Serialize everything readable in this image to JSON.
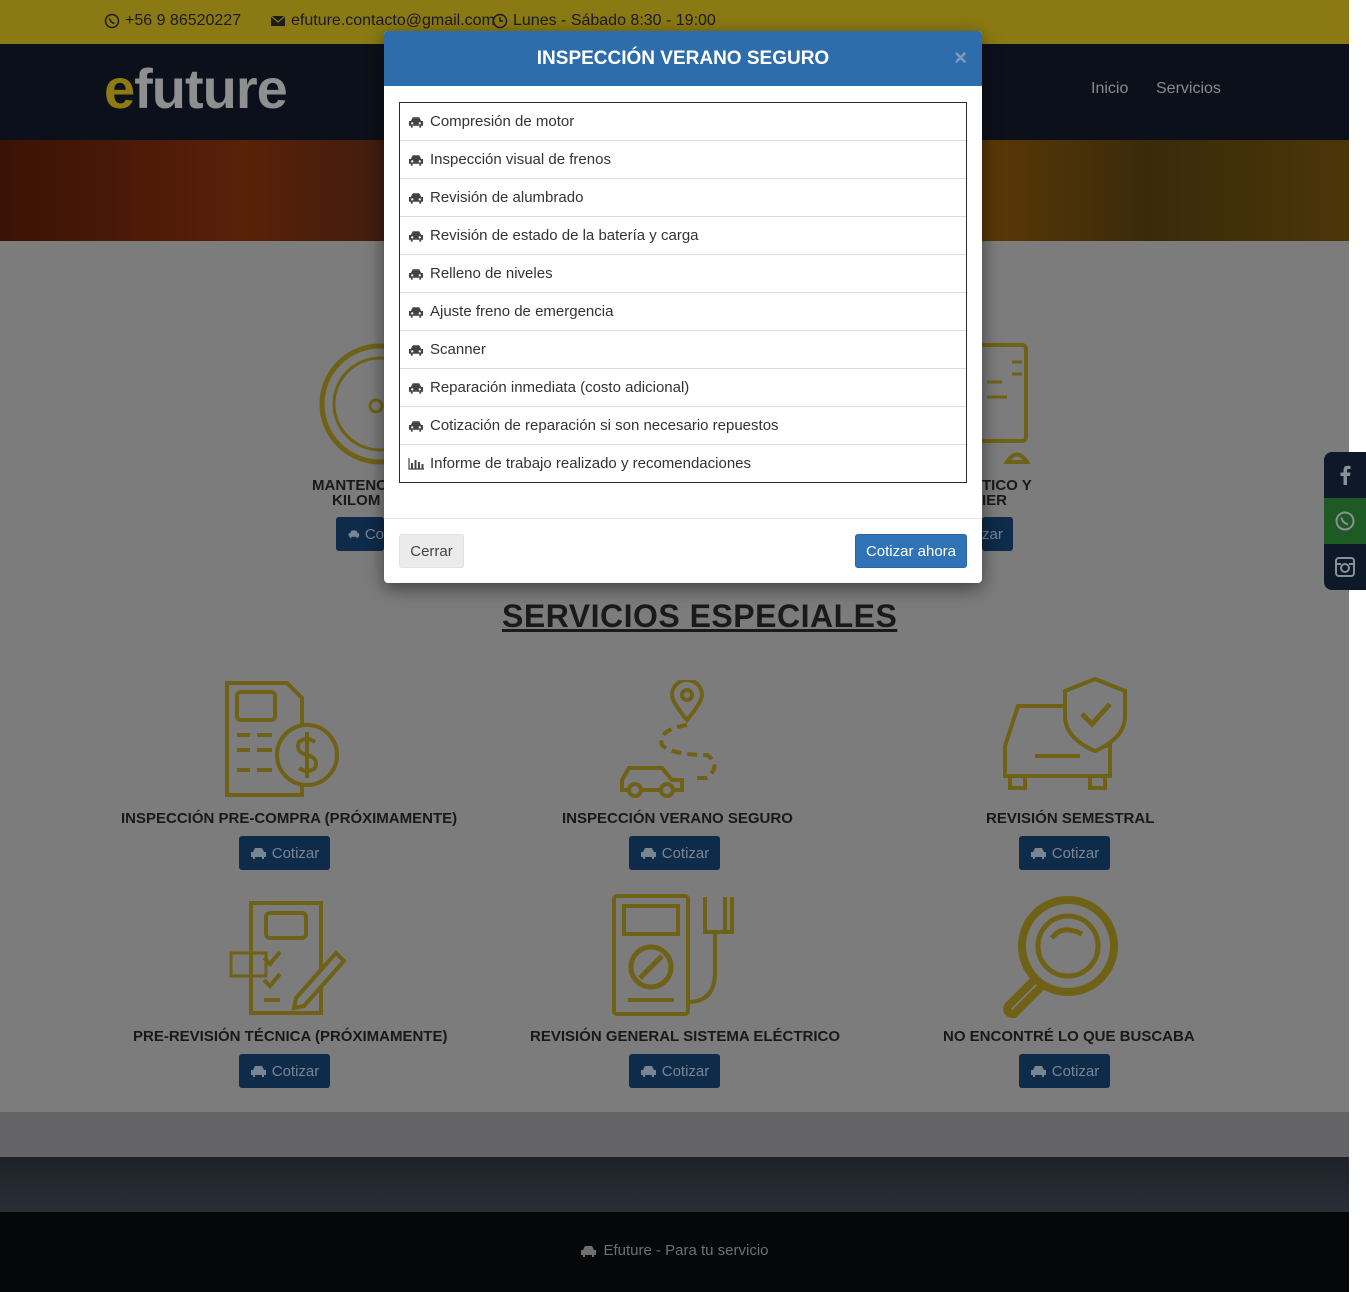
{
  "topbar": {
    "phone": "+56 9 86520227",
    "email": "efuture.contacto@gmail.com",
    "hours": "Lunes - Sábado 8:30 - 19:00"
  },
  "nav": {
    "logo_e": "e",
    "logo_rest": "future",
    "links": [
      "Inicio",
      "Servicios"
    ]
  },
  "services_top": {
    "left_title_line1": "MANTENC",
    "left_title_line2": "KILOM",
    "right_title_line1": "TICO Y",
    "right_title_line2": "IER",
    "left_button": "Co",
    "right_button": "zar"
  },
  "special": {
    "heading": "SERVICIOS ESPECIALES",
    "button_label": "Cotizar",
    "items": [
      {
        "title": "INSPECCIÓN PRE-COMPRA (PRÓXIMAMENTE)",
        "icon": "document-dollar-icon"
      },
      {
        "title": "INSPECCIÓN VERANO SEGURO",
        "icon": "route-car-icon"
      },
      {
        "title": "REVISIÓN SEMESTRAL",
        "icon": "car-shield-icon"
      },
      {
        "title": "PRE-REVISIÓN TÉCNICA (PRÓXIMAMENTE)",
        "icon": "checklist-pen-icon"
      },
      {
        "title": "REVISIÓN GENERAL SISTEMA ELÉCTRICO",
        "icon": "multimeter-icon"
      },
      {
        "title": "NO ENCONTRÉ LO QUE BUSCABA",
        "icon": "magnifier-icon"
      }
    ]
  },
  "footer": {
    "text": "Efuture - Para tu servicio"
  },
  "social": [
    "facebook-icon",
    "whatsapp-icon",
    "instagram-icon"
  ],
  "colors": {
    "brand_yellow": "#d4b417",
    "modal_header": "#2e6dac",
    "button_blue": "#1f4f82"
  },
  "modal": {
    "title": "INSPECCIÓN VERANO SEGURO",
    "close": "×",
    "items": [
      {
        "label": "Compresión de motor",
        "icon": "car-icon"
      },
      {
        "label": "Inspección visual de frenos",
        "icon": "car-icon"
      },
      {
        "label": "Revisión de alumbrado",
        "icon": "car-icon"
      },
      {
        "label": "Revisión de estado de la batería y carga",
        "icon": "car-icon"
      },
      {
        "label": "Relleno de niveles",
        "icon": "car-icon"
      },
      {
        "label": "Ajuste freno de emergencia",
        "icon": "car-icon"
      },
      {
        "label": "Scanner",
        "icon": "car-icon"
      },
      {
        "label": "Reparación inmediata (costo adicional)",
        "icon": "car-icon"
      },
      {
        "label": "Cotización de reparación si son necesario repuestos",
        "icon": "car-icon"
      },
      {
        "label": "Informe de trabajo realizado y recomendaciones",
        "icon": "bar-chart-icon"
      }
    ],
    "close_button": "Cerrar",
    "quote_button": "Cotizar ahora"
  }
}
